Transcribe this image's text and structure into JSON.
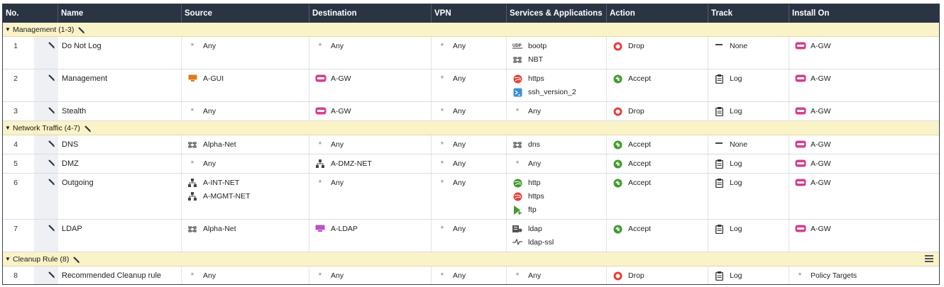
{
  "columns": [
    "No.",
    "Name",
    "Source",
    "Destination",
    "VPN",
    "Services & Applications",
    "Action",
    "Track",
    "Install On"
  ],
  "sections": [
    {
      "title": "Management (1-3)",
      "rules": [
        {
          "no": "1",
          "name": "Do Not Log",
          "source": [
            {
              "icon": "any-icon",
              "label": "Any"
            }
          ],
          "destination": [
            {
              "icon": "any-icon",
              "label": "Any"
            }
          ],
          "vpn": [
            {
              "icon": "any-icon",
              "label": "Any"
            }
          ],
          "services": [
            {
              "icon": "udp-icon",
              "label": "bootp"
            },
            {
              "icon": "group-icon",
              "label": "NBT"
            }
          ],
          "action": {
            "icon": "drop-icon",
            "label": "Drop"
          },
          "track": {
            "icon": "none-icon",
            "label": "None"
          },
          "install": [
            {
              "icon": "gateway-icon",
              "label": "A-GW"
            }
          ]
        },
        {
          "no": "2",
          "name": "Management",
          "source": [
            {
              "icon": "host-icon",
              "label": "A-GUI"
            }
          ],
          "destination": [
            {
              "icon": "gateway-icon",
              "label": "A-GW"
            }
          ],
          "vpn": [
            {
              "icon": "any-icon",
              "label": "Any"
            }
          ],
          "services": [
            {
              "icon": "https-icon",
              "label": "https"
            },
            {
              "icon": "ssh-icon",
              "label": "ssh_version_2"
            }
          ],
          "action": {
            "icon": "accept-icon",
            "label": "Accept"
          },
          "track": {
            "icon": "log-icon",
            "label": "Log"
          },
          "install": [
            {
              "icon": "gateway-icon",
              "label": "A-GW"
            }
          ]
        },
        {
          "no": "3",
          "name": "Stealth",
          "source": [
            {
              "icon": "any-icon",
              "label": "Any"
            }
          ],
          "destination": [
            {
              "icon": "gateway-icon",
              "label": "A-GW"
            }
          ],
          "vpn": [
            {
              "icon": "any-icon",
              "label": "Any"
            }
          ],
          "services": [
            {
              "icon": "any-icon",
              "label": "Any"
            }
          ],
          "action": {
            "icon": "drop-icon",
            "label": "Drop"
          },
          "track": {
            "icon": "log-icon",
            "label": "Log"
          },
          "install": [
            {
              "icon": "gateway-icon",
              "label": "A-GW"
            }
          ]
        }
      ]
    },
    {
      "title": "Network Traffic (4-7)",
      "rules": [
        {
          "no": "4",
          "name": "DNS",
          "source": [
            {
              "icon": "group-icon",
              "label": "Alpha-Net"
            }
          ],
          "destination": [
            {
              "icon": "any-icon",
              "label": "Any"
            }
          ],
          "vpn": [
            {
              "icon": "any-icon",
              "label": "Any"
            }
          ],
          "services": [
            {
              "icon": "group-icon",
              "label": "dns"
            }
          ],
          "action": {
            "icon": "accept-icon",
            "label": "Accept"
          },
          "track": {
            "icon": "none-icon",
            "label": "None"
          },
          "install": [
            {
              "icon": "gateway-icon",
              "label": "A-GW"
            }
          ]
        },
        {
          "no": "5",
          "name": "DMZ",
          "source": [
            {
              "icon": "any-icon",
              "label": "Any"
            }
          ],
          "destination": [
            {
              "icon": "network-icon",
              "label": "A-DMZ-NET"
            }
          ],
          "vpn": [
            {
              "icon": "any-icon",
              "label": "Any"
            }
          ],
          "services": [
            {
              "icon": "any-icon",
              "label": "Any"
            }
          ],
          "action": {
            "icon": "accept-icon",
            "label": "Accept"
          },
          "track": {
            "icon": "log-icon",
            "label": "Log"
          },
          "install": [
            {
              "icon": "gateway-icon",
              "label": "A-GW"
            }
          ]
        },
        {
          "no": "6",
          "name": "Outgoing",
          "source": [
            {
              "icon": "network-icon",
              "label": "A-INT-NET"
            },
            {
              "icon": "network-icon",
              "label": "A-MGMT-NET"
            }
          ],
          "destination": [
            {
              "icon": "any-icon",
              "label": "Any"
            }
          ],
          "vpn": [
            {
              "icon": "any-icon",
              "label": "Any"
            }
          ],
          "services": [
            {
              "icon": "http-icon",
              "label": "http"
            },
            {
              "icon": "https-icon",
              "label": "https"
            },
            {
              "icon": "ftp-icon",
              "label": "ftp"
            }
          ],
          "action": {
            "icon": "accept-icon",
            "label": "Accept"
          },
          "track": {
            "icon": "log-icon",
            "label": "Log"
          },
          "install": [
            {
              "icon": "gateway-icon",
              "label": "A-GW"
            }
          ]
        },
        {
          "no": "7",
          "name": "LDAP",
          "source": [
            {
              "icon": "group-icon",
              "label": "Alpha-Net"
            }
          ],
          "destination": [
            {
              "icon": "server-icon",
              "label": "A-LDAP"
            }
          ],
          "vpn": [
            {
              "icon": "any-icon",
              "label": "Any"
            }
          ],
          "services": [
            {
              "icon": "ldap-icon",
              "label": "ldap"
            },
            {
              "icon": "ldap-ssl-icon",
              "label": "ldap-ssl"
            }
          ],
          "action": {
            "icon": "accept-icon",
            "label": "Accept"
          },
          "track": {
            "icon": "log-icon",
            "label": "Log"
          },
          "install": [
            {
              "icon": "gateway-icon",
              "label": "A-GW"
            }
          ]
        }
      ]
    },
    {
      "title": "Cleanup Rule (8)",
      "rules": [
        {
          "no": "8",
          "name": "Recommended Cleanup rule",
          "source": [
            {
              "icon": "any-icon",
              "label": "Any"
            }
          ],
          "destination": [
            {
              "icon": "any-icon",
              "label": "Any"
            }
          ],
          "vpn": [
            {
              "icon": "any-icon",
              "label": "Any"
            }
          ],
          "services": [
            {
              "icon": "any-icon",
              "label": "Any"
            }
          ],
          "action": {
            "icon": "drop-icon",
            "label": "Drop"
          },
          "track": {
            "icon": "log-icon",
            "label": "Log"
          },
          "install": [
            {
              "icon": "any-icon",
              "label": "Policy Targets"
            }
          ]
        }
      ]
    }
  ],
  "colors": {
    "header_bg": "#2b3443",
    "section_bg": "#fbf3c8",
    "drop": "#e5413a",
    "accept": "#3e9b2c",
    "gateway": "#d43f8d",
    "host": "#e07b1a"
  }
}
